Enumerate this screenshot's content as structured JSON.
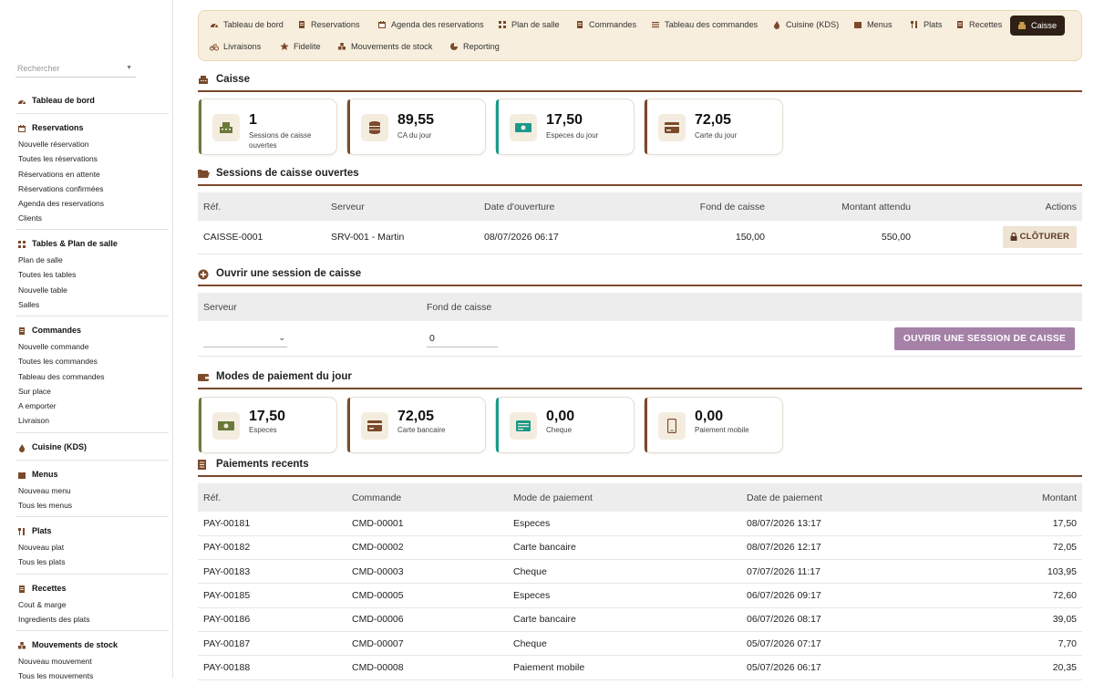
{
  "search": {
    "placeholder": "Rechercher"
  },
  "sidebar": {
    "sections": [
      {
        "title": "Tableau de bord",
        "items": []
      },
      {
        "title": "Reservations",
        "items": [
          "Nouvelle réservation",
          "Toutes les réservations",
          "Réservations en attente",
          "Réservations confirmées",
          "Agenda des reservations",
          "Clients"
        ]
      },
      {
        "title": "Tables & Plan de salle",
        "items": [
          "Plan de salle",
          "Toutes les tables",
          "Nouvelle table",
          "Salles"
        ]
      },
      {
        "title": "Commandes",
        "items": [
          "Nouvelle commande",
          "Toutes les commandes",
          "Tableau des commandes",
          "Sur place",
          "A emporter",
          "Livraison"
        ]
      },
      {
        "title": "Cuisine (KDS)",
        "items": []
      },
      {
        "title": "Menus",
        "items": [
          "Nouveau menu",
          "Tous les menus"
        ]
      },
      {
        "title": "Plats",
        "items": [
          "Nouveau plat",
          "Tous les plats"
        ]
      },
      {
        "title": "Recettes",
        "items": [
          "Cout & marge",
          "Ingredients des plats"
        ]
      },
      {
        "title": "Mouvements de stock",
        "items": [
          "Nouveau mouvement",
          "Tous les mouvements"
        ]
      }
    ]
  },
  "topnav": {
    "items": [
      "Tableau de bord",
      "Reservations",
      "Agenda des reservations",
      "Plan de salle",
      "Commandes",
      "Tableau des commandes",
      "Cuisine (KDS)",
      "Menus",
      "Plats",
      "Recettes",
      "Caisse",
      "Livraisons",
      "Fidelite",
      "Mouvements de stock",
      "Reporting"
    ],
    "active": "Caisse"
  },
  "page_title": "Caisse",
  "kpis": [
    {
      "value": "1",
      "label": "Sessions de caisse ouvertes",
      "accent": "#6b7a3a"
    },
    {
      "value": "89,55",
      "label": "CA du jour",
      "accent": "#7a4a2a"
    },
    {
      "value": "17,50",
      "label": "Especes du jour",
      "accent": "#1a9a8a"
    },
    {
      "value": "72,05",
      "label": "Carte du jour",
      "accent": "#7a4a2a"
    }
  ],
  "sessions": {
    "title": "Sessions de caisse ouvertes",
    "headers": [
      "Réf.",
      "Serveur",
      "Date d'ouverture",
      "Fond de caisse",
      "Montant attendu",
      "Actions"
    ],
    "rows": [
      [
        "CAISSE-0001",
        "SRV-001 - Martin",
        "08/07/2026 06:17",
        "150,00",
        "550,00"
      ]
    ],
    "close_label": "CLÔTURER"
  },
  "open_session": {
    "title": "Ouvrir une session de caisse",
    "serveur_label": "Serveur",
    "fond_label": "Fond de caisse",
    "fond_value": "0",
    "button_label": "OUVRIR UNE SESSION DE CAISSE"
  },
  "modes": {
    "title": "Modes de paiement du jour",
    "cards": [
      {
        "value": "17,50",
        "label": "Especes",
        "accent": "#6b7a3a"
      },
      {
        "value": "72,05",
        "label": "Carte bancaire",
        "accent": "#7a4a2a"
      },
      {
        "value": "0,00",
        "label": "Cheque",
        "accent": "#1a9a8a"
      },
      {
        "value": "0,00",
        "label": "Paiement mobile",
        "accent": "#7a4a2a"
      }
    ]
  },
  "payments": {
    "title": "Paiements recents",
    "headers": [
      "Réf.",
      "Commande",
      "Mode de paiement",
      "Date de paiement",
      "Montant"
    ],
    "rows": [
      [
        "PAY-00181",
        "CMD-00001",
        "Especes",
        "08/07/2026 13:17",
        "17,50"
      ],
      [
        "PAY-00182",
        "CMD-00002",
        "Carte bancaire",
        "08/07/2026 12:17",
        "72,05"
      ],
      [
        "PAY-00183",
        "CMD-00003",
        "Cheque",
        "07/07/2026 11:17",
        "103,95"
      ],
      [
        "PAY-00185",
        "CMD-00005",
        "Especes",
        "06/07/2026 09:17",
        "72,60"
      ],
      [
        "PAY-00186",
        "CMD-00006",
        "Carte bancaire",
        "06/07/2026 08:17",
        "39,05"
      ],
      [
        "PAY-00187",
        "CMD-00007",
        "Cheque",
        "05/07/2026 07:17",
        "7,70"
      ],
      [
        "PAY-00188",
        "CMD-00008",
        "Paiement mobile",
        "05/07/2026 06:17",
        "20,35"
      ]
    ]
  }
}
